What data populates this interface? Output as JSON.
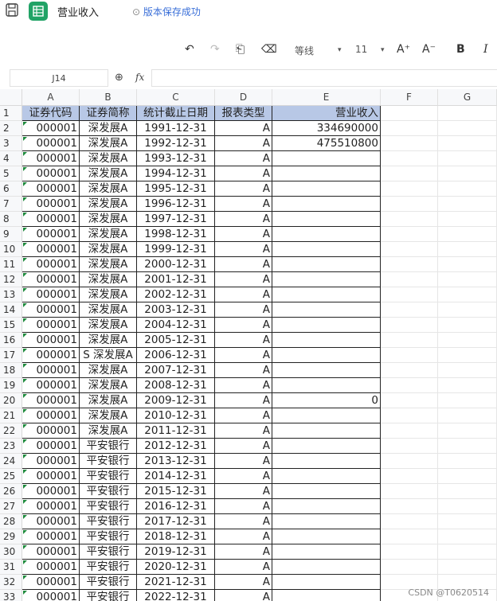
{
  "app": {
    "doc_title": "营业收入",
    "save_status": "版本保存成功"
  },
  "toolbar": {
    "font_name": "等线",
    "font_size": "11",
    "increase_font": "A⁺",
    "decrease_font": "A⁻",
    "bold": "B",
    "italic": "I"
  },
  "formula_bar": {
    "cell_ref": "J14",
    "fx_label": "fx",
    "value": ""
  },
  "sheet": {
    "columns": [
      "A",
      "B",
      "C",
      "D",
      "E",
      "F",
      "G"
    ],
    "headers": [
      "证券代码",
      "证券简称",
      "统计截止日期",
      "报表类型",
      "营业收入"
    ],
    "rows": [
      [
        "000001",
        "深发展A",
        "1991-12-31",
        "A",
        "334690000"
      ],
      [
        "000001",
        "深发展A",
        "1992-12-31",
        "A",
        "475510800"
      ],
      [
        "000001",
        "深发展A",
        "1993-12-31",
        "A",
        ""
      ],
      [
        "000001",
        "深发展A",
        "1994-12-31",
        "A",
        ""
      ],
      [
        "000001",
        "深发展A",
        "1995-12-31",
        "A",
        ""
      ],
      [
        "000001",
        "深发展A",
        "1996-12-31",
        "A",
        ""
      ],
      [
        "000001",
        "深发展A",
        "1997-12-31",
        "A",
        ""
      ],
      [
        "000001",
        "深发展A",
        "1998-12-31",
        "A",
        ""
      ],
      [
        "000001",
        "深发展A",
        "1999-12-31",
        "A",
        ""
      ],
      [
        "000001",
        "深发展A",
        "2000-12-31",
        "A",
        ""
      ],
      [
        "000001",
        "深发展A",
        "2001-12-31",
        "A",
        ""
      ],
      [
        "000001",
        "深发展A",
        "2002-12-31",
        "A",
        ""
      ],
      [
        "000001",
        "深发展A",
        "2003-12-31",
        "A",
        ""
      ],
      [
        "000001",
        "深发展A",
        "2004-12-31",
        "A",
        ""
      ],
      [
        "000001",
        "深发展A",
        "2005-12-31",
        "A",
        ""
      ],
      [
        "000001",
        "S 深发展A",
        "2006-12-31",
        "A",
        ""
      ],
      [
        "000001",
        "深发展A",
        "2007-12-31",
        "A",
        ""
      ],
      [
        "000001",
        "深发展A",
        "2008-12-31",
        "A",
        ""
      ],
      [
        "000001",
        "深发展A",
        "2009-12-31",
        "A",
        "0"
      ],
      [
        "000001",
        "深发展A",
        "2010-12-31",
        "A",
        ""
      ],
      [
        "000001",
        "深发展A",
        "2011-12-31",
        "A",
        ""
      ],
      [
        "000001",
        "平安银行",
        "2012-12-31",
        "A",
        ""
      ],
      [
        "000001",
        "平安银行",
        "2013-12-31",
        "A",
        ""
      ],
      [
        "000001",
        "平安银行",
        "2014-12-31",
        "A",
        ""
      ],
      [
        "000001",
        "平安银行",
        "2015-12-31",
        "A",
        ""
      ],
      [
        "000001",
        "平安银行",
        "2016-12-31",
        "A",
        ""
      ],
      [
        "000001",
        "平安银行",
        "2017-12-31",
        "A",
        ""
      ],
      [
        "000001",
        "平安银行",
        "2018-12-31",
        "A",
        ""
      ],
      [
        "000001",
        "平安银行",
        "2019-12-31",
        "A",
        ""
      ],
      [
        "000001",
        "平安银行",
        "2020-12-31",
        "A",
        ""
      ],
      [
        "000001",
        "平安银行",
        "2021-12-31",
        "A",
        ""
      ],
      [
        "000001",
        "平安银行",
        "2022-12-31",
        "A",
        ""
      ]
    ]
  },
  "watermark": "CSDN @T0620514",
  "colors": {
    "header_fill": "#b8c8e6",
    "app_icon": "#21a366",
    "save_status": "#3a6fd8"
  }
}
